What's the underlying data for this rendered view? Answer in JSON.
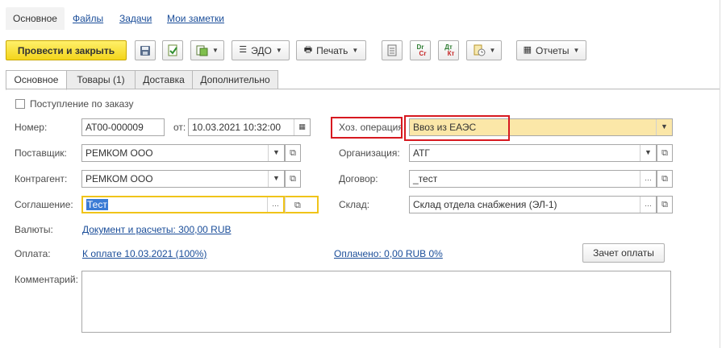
{
  "nav": {
    "tabs": [
      {
        "label": "Основное"
      },
      {
        "label": "Файлы"
      },
      {
        "label": "Задачи"
      },
      {
        "label": "Мои заметки"
      }
    ]
  },
  "toolbar": {
    "post_close": "Провести и закрыть",
    "edo": "ЭДО",
    "print": "Печать",
    "dt_cr_dt": "Dr",
    "dt_cr_cr": "Cr",
    "dt_kt_dt": "Дт",
    "dt_kt_kt": "Кт",
    "reports": "Отчеты"
  },
  "form_tabs": [
    "Основное",
    "Товары (1)",
    "Доставка",
    "Дополнительно"
  ],
  "form": {
    "order_receipt_label": "Поступление по заказу",
    "number_label": "Номер:",
    "number_value": "АТ00-000009",
    "date_from_label": "от:",
    "date_value": "10.03.2021 10:32:00",
    "operation_label": "Хоз. операция:",
    "operation_value": "Ввоз из ЕАЭС",
    "supplier_label": "Поставщик:",
    "supplier_value": "РЕМКОМ ООО",
    "organization_label": "Организация:",
    "organization_value": "АТГ",
    "counterparty_label": "Контрагент:",
    "counterparty_value": "РЕМКОМ ООО",
    "contract_label": "Договор:",
    "contract_value": "_тест",
    "agreement_label": "Соглашение:",
    "agreement_value": "Тест",
    "warehouse_label": "Склад:",
    "warehouse_value": "Склад отдела снабжения (ЭЛ-1)",
    "currency_label": "Валюты:",
    "currency_link": "Документ и расчеты: 300,00 RUB",
    "payment_label": "Оплата:",
    "payment_link": "К оплате 10.03.2021 (100%)",
    "paid_link": "Оплачено: 0,00 RUB  0%",
    "offset_button": "Зачет оплаты",
    "comment_label": "Комментарий:",
    "comment_value": ""
  }
}
